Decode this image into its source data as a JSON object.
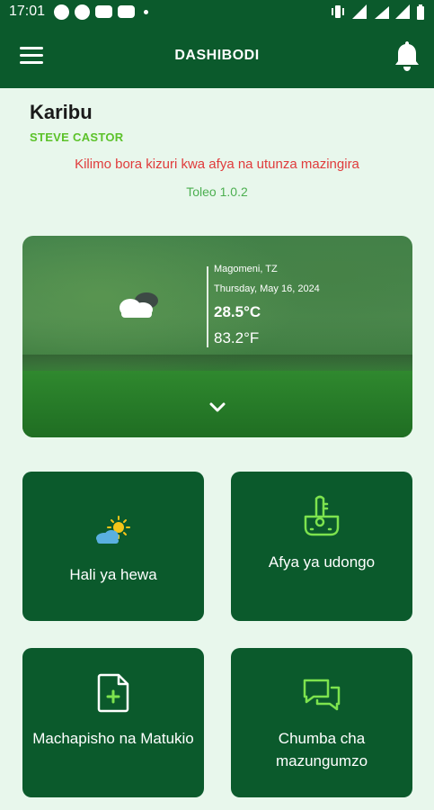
{
  "status_bar": {
    "time": "17:01"
  },
  "app_bar": {
    "title": "DASHIBODI"
  },
  "greeting": {
    "title": "Karibu",
    "username": "STEVE CASTOR",
    "slogan": "Kilimo bora kizuri kwa afya na utunza mazingira",
    "version": "Toleo 1.0.2"
  },
  "weather": {
    "location": "Magomeni, TZ",
    "date": "Thursday, May 16, 2024",
    "temp_c": "28.5°C",
    "temp_f": "83.2°F",
    "icon": "cloud-icon"
  },
  "tiles": [
    {
      "label": "Hali ya hewa",
      "icon": "weather-icon"
    },
    {
      "label": "Afya ya udongo",
      "icon": "soil-thermometer-icon"
    },
    {
      "label": "Machapisho na Matukio",
      "icon": "add-document-icon"
    },
    {
      "label": "Chumba cha mazungumzo",
      "icon": "chat-icon"
    }
  ],
  "colors": {
    "primary": "#0b5a2c",
    "background": "#e8f7ec",
    "username": "#5cc22a",
    "slogan": "#e03b3b",
    "version": "#4caf50"
  }
}
